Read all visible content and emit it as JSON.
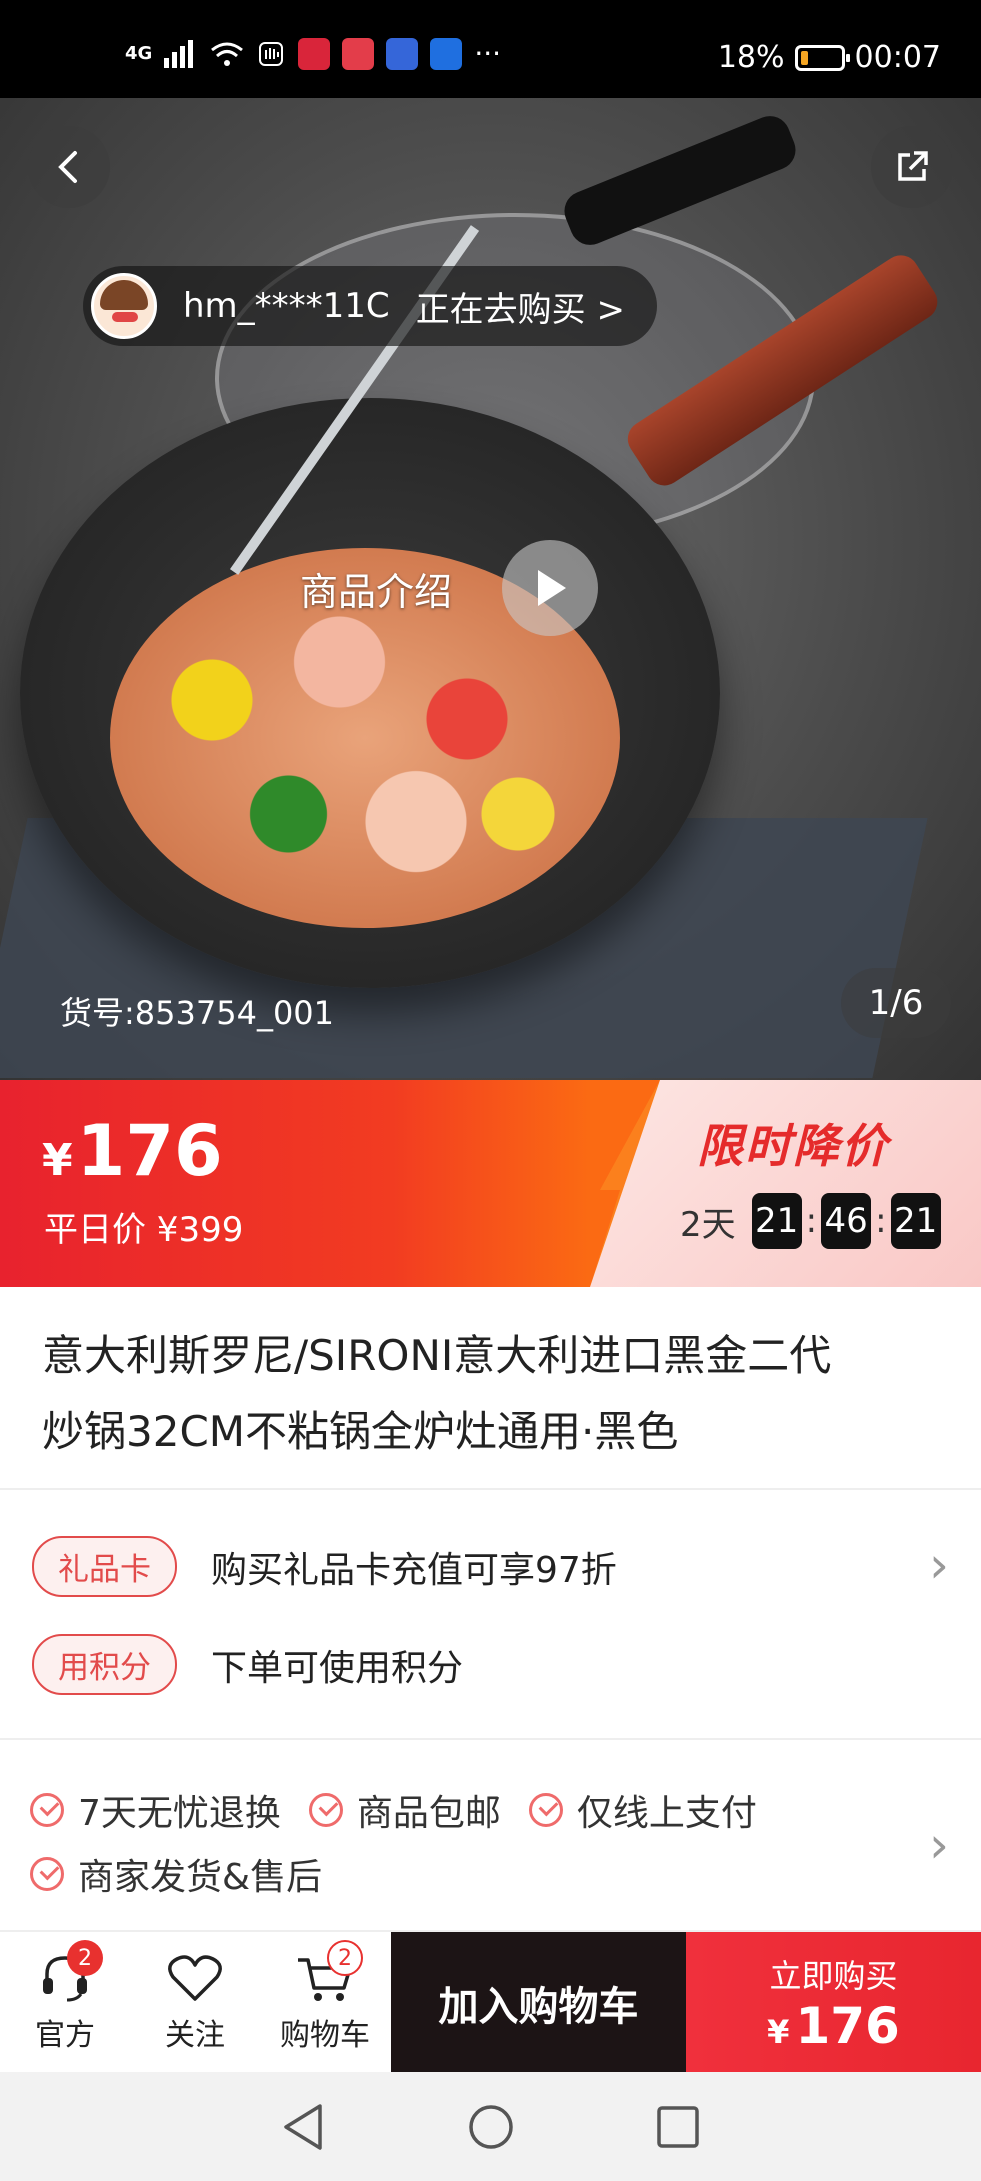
{
  "status_bar": {
    "signal_text": "4G",
    "battery_percent": "18%",
    "battery_level": 0.18,
    "time": "00:07",
    "more": "···"
  },
  "hero": {
    "buyer_name": "hm_****11C",
    "buyer_action": "正在去购买 >",
    "intro_label": "商品介绍",
    "sku": "货号:853754_001",
    "page_indicator": "1/6"
  },
  "price": {
    "currency": "¥",
    "current": "176",
    "usual_label": "平日价 ¥399",
    "flash_title": "限时降价",
    "countdown": {
      "days": "2天",
      "hours": "21",
      "minutes": "46",
      "seconds": "21",
      "sep": ":"
    }
  },
  "product": {
    "title_line1": "意大利斯罗尼/SIRONI意大利进口黑金二代",
    "title_line2": "炒锅32CM不粘锅全炉灶通用·黑色"
  },
  "promos": [
    {
      "tag": "礼品卡",
      "text": "购买礼品卡充值可享97折"
    },
    {
      "tag": "用积分",
      "text": "下单可使用积分"
    }
  ],
  "guarantees": [
    "7天无忧退换",
    "商品包邮",
    "仅线上支付",
    "商家发货&售后"
  ],
  "action_bar": {
    "service_label": "官方",
    "service_badge": "2",
    "follow_label": "关注",
    "cart_label": "购物车",
    "cart_badge": "2",
    "add_to_cart": "加入购物车",
    "buy_now": "立即购买",
    "buy_price_currency": "¥",
    "buy_price": "176"
  },
  "colors": {
    "accent_red": "#e8312f",
    "banner_orange": "#fb6a13",
    "dark_button": "#1c1415"
  }
}
